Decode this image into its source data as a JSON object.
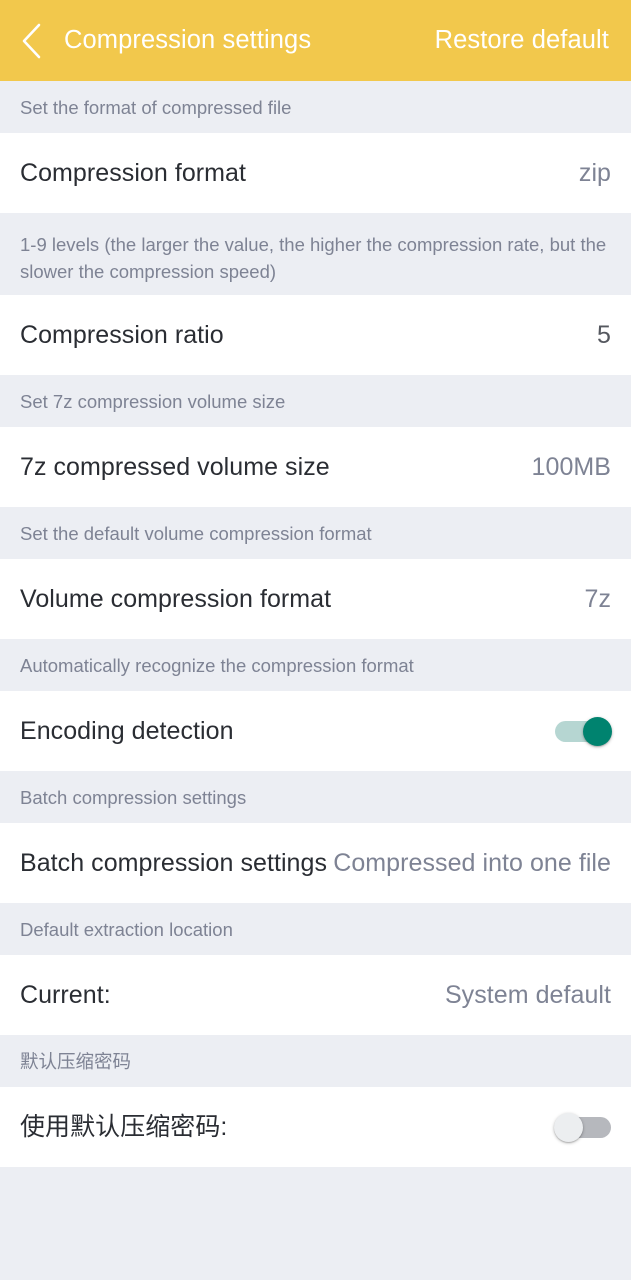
{
  "appbar": {
    "back_icon": "chevron-left-icon",
    "title": "Compression settings",
    "action_label": "Restore default",
    "background_color": "#F2C84C",
    "text_color": "#FFFFFF"
  },
  "theme": {
    "page_background": "#ECEEF3",
    "row_background": "#FFFFFF",
    "caption_color": "#7E8394",
    "label_color": "#2A2D33",
    "value_color": "#7E8394",
    "toggle_on_color": "#00836F",
    "toggle_on_track_color": "#B6D6D2",
    "toggle_off_thumb_color": "#ECEEF0",
    "toggle_off_track_color": "#B6B8BD"
  },
  "sections": [
    {
      "caption": "Set the format of compressed file",
      "row": {
        "label": "Compression format",
        "value": "zip",
        "type": "value"
      }
    },
    {
      "caption": "1-9 levels (the larger the value, the higher the compression rate, but the slower the compression speed)",
      "row": {
        "label": "Compression ratio",
        "value": "5",
        "type": "value"
      }
    },
    {
      "caption": "Set 7z compression volume size",
      "row": {
        "label": "7z compressed volume size",
        "value": "100MB",
        "type": "value"
      }
    },
    {
      "caption": "Set the default volume compression format",
      "row": {
        "label": "Volume compression format",
        "value": "7z",
        "type": "value"
      }
    },
    {
      "caption": "Automatically recognize the compression format",
      "row": {
        "label": "Encoding detection",
        "value": "",
        "type": "toggle",
        "toggle_state": "on"
      }
    },
    {
      "caption": "Batch compression settings",
      "row": {
        "label": "Batch compression settings",
        "value": "Compressed into one file",
        "type": "value-overlap"
      }
    },
    {
      "caption": "Default extraction location",
      "row": {
        "label": "Current:",
        "value": "System default",
        "type": "value"
      }
    },
    {
      "caption": "默认压缩密码",
      "row": {
        "label": "使用默认压缩密码:",
        "value": "",
        "type": "toggle",
        "toggle_state": "off"
      }
    }
  ]
}
